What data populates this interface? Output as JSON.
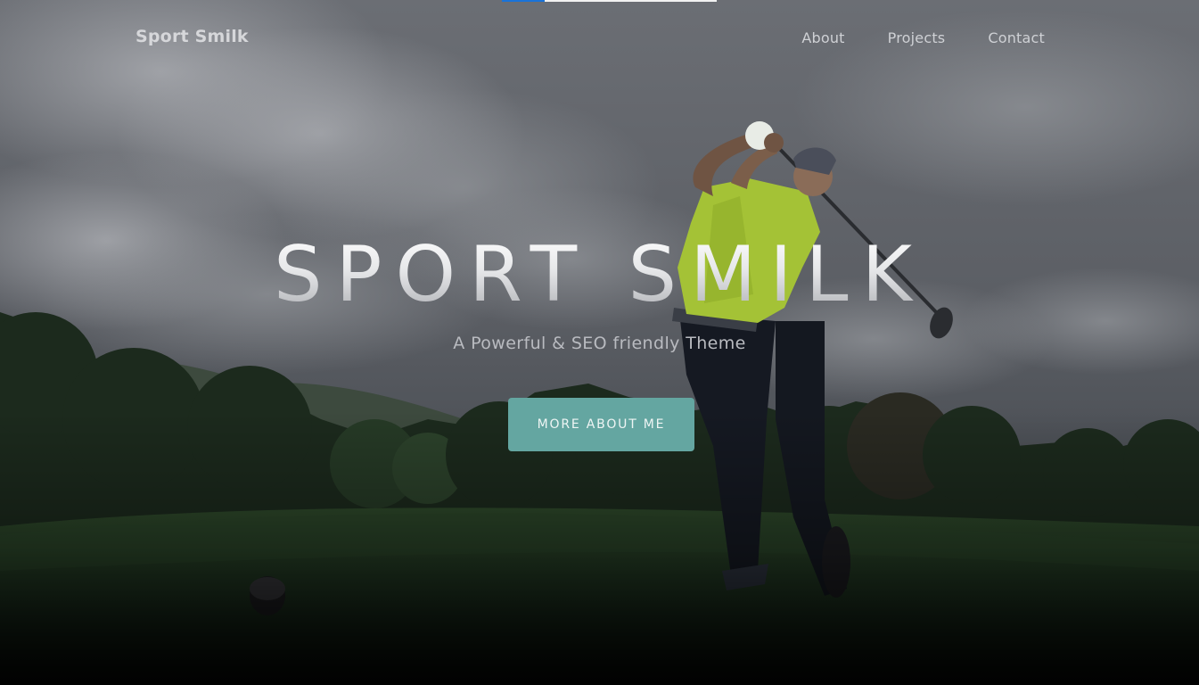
{
  "header": {
    "brand": "Sport Smilk",
    "nav": [
      "About",
      "Projects",
      "Contact"
    ]
  },
  "hero": {
    "title": "SPORT SMILK",
    "subtitle": "A Powerful & SEO friendly Theme",
    "cta_label": "MORE ABOUT ME"
  },
  "page_load_progress": 0.2,
  "colors": {
    "accent": "#64a6a1",
    "progress": "#1a73d8"
  }
}
